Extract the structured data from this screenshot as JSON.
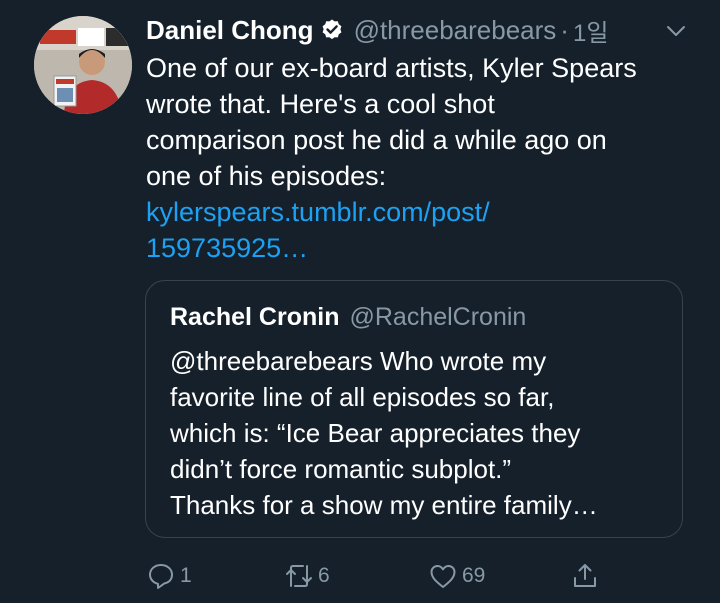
{
  "tweet": {
    "display_name": "Daniel Chong",
    "handle": "@threebarebears",
    "separator": "·",
    "time": "1일",
    "avatar_icon": "profile-photo",
    "body_lines": [
      "One of our ex-board artists, Kyler Spears",
      "wrote that. Here's a cool shot",
      "comparison post he did a while ago on",
      "one of his episodes:"
    ],
    "link_lines": [
      "kylerspears.tumblr.com/post/",
      "159735925…"
    ]
  },
  "quoted_tweet": {
    "display_name": "Rachel Cronin",
    "handle": "@RachelCronin",
    "lines": [
      "@threebarebears  Who wrote my",
      "favorite line of all episodes so far,",
      "which is: “Ice Bear appreciates they",
      "didn’t force romantic subplot.”",
      "Thanks for a show my entire family…"
    ]
  },
  "actions": {
    "reply_count": "1",
    "retweet_count": "6",
    "like_count": "69"
  },
  "colors": {
    "background": "#15202b",
    "text": "#ffffff",
    "secondary": "#8899a6",
    "link": "#1da1f2",
    "border": "#38444d"
  }
}
